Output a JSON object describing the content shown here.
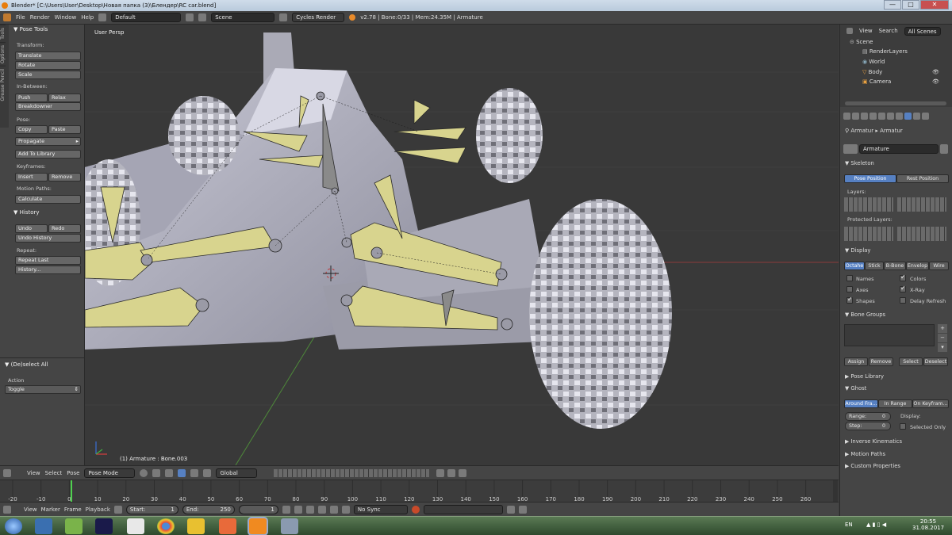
{
  "window": {
    "title": "Blender* [C:\\Users\\User\\Desktop\\Новая папка (3)\\Блендер\\RC car.blend]",
    "min": "—",
    "max": "□",
    "close": "✕"
  },
  "infobar": {
    "menus": [
      "File",
      "Render",
      "Window",
      "Help"
    ],
    "layout": "Default",
    "scene": "Scene",
    "engine": "Cycles Render",
    "stats": "v2.78 | Bone:0/33 | Mem:24.35M | Armature"
  },
  "tool_tabs": [
    "Tools",
    "Options",
    "Grease Pencil"
  ],
  "pose_tools": {
    "title": "Pose Tools",
    "transform_label": "Transform:",
    "translate": "Translate",
    "rotate": "Rotate",
    "scale": "Scale",
    "inbetween_label": "In-Between:",
    "push": "Push",
    "relax": "Relax",
    "breakdowner": "Breakdowner",
    "pose_label": "Pose:",
    "copy": "Copy",
    "paste": "Paste",
    "propagate": "Propagate",
    "add_to_library": "Add To Library",
    "keyframes_label": "Keyframes:",
    "insert": "Insert",
    "remove": "Remove",
    "motion_paths_label": "Motion Paths:",
    "calculate": "Calculate"
  },
  "history": {
    "title": "History",
    "undo": "Undo",
    "redo": "Redo",
    "undo_history": "Undo History",
    "repeat_label": "Repeat:",
    "repeat_last": "Repeat Last",
    "history_btn": "History..."
  },
  "operator": {
    "title": "(De)select All",
    "action_label": "Action",
    "action_value": "Toggle"
  },
  "viewport": {
    "label": "User Persp",
    "status": "(1) Armature : Bone.003"
  },
  "outliner": {
    "tabs": [
      "View",
      "Search",
      "All Scenes"
    ],
    "items": [
      "Scene",
      "RenderLayers",
      "World",
      "Body",
      "Camera"
    ]
  },
  "properties": {
    "breadcrumb1": "Armatur",
    "breadcrumb2": "Armatur",
    "name": "Armature",
    "skeleton": {
      "title": "Skeleton",
      "pose_position": "Pose Position",
      "rest_position": "Rest Position",
      "layers": "Layers:",
      "protected_layers": "Protected Layers:"
    },
    "display": {
      "title": "Display",
      "modes": [
        "Octahe",
        "Stick",
        "B-Bone",
        "Envelop",
        "Wire"
      ],
      "names": "Names",
      "colors": "Colors",
      "axes": "Axes",
      "xray": "X-Ray",
      "shapes": "Shapes",
      "delay_refresh": "Delay Refresh"
    },
    "bone_groups": {
      "title": "Bone Groups",
      "assign": "Assign",
      "remove": "Remove",
      "select": "Select",
      "deselect": "Deselect"
    },
    "pose_library": "Pose Library",
    "ghost": {
      "title": "Ghost",
      "modes": [
        "Around Fra...",
        "In Range",
        "On Keyfram..."
      ],
      "range": "Range:",
      "range_val": "0",
      "step": "Step:",
      "step_val": "0",
      "display": "Display:",
      "selected_only": "Selected Only"
    },
    "inverse_kinematics": "Inverse Kinematics",
    "motion_paths": "Motion Paths",
    "custom_properties": "Custom Properties"
  },
  "view_header": {
    "menus": [
      "View",
      "Select",
      "Pose"
    ],
    "mode": "Pose Mode",
    "orientation": "Global"
  },
  "timeline": {
    "ticks": [
      "-20",
      "-10",
      "0",
      "10",
      "20",
      "30",
      "40",
      "50",
      "60",
      "70",
      "80",
      "90",
      "100",
      "110",
      "120",
      "130",
      "140",
      "150",
      "160",
      "170",
      "180",
      "190",
      "200",
      "210",
      "220",
      "230",
      "240",
      "250",
      "260"
    ],
    "current_frame": 1
  },
  "timeline_header": {
    "menus": [
      "View",
      "Marker",
      "Frame",
      "Playback"
    ],
    "start_label": "Start:",
    "start_val": "1",
    "end_label": "End:",
    "end_val": "250",
    "frame_val": "1",
    "sync": "No Sync"
  },
  "taskbar": {
    "lang": "EN",
    "time": "20:55",
    "date": "31.08.2017"
  }
}
